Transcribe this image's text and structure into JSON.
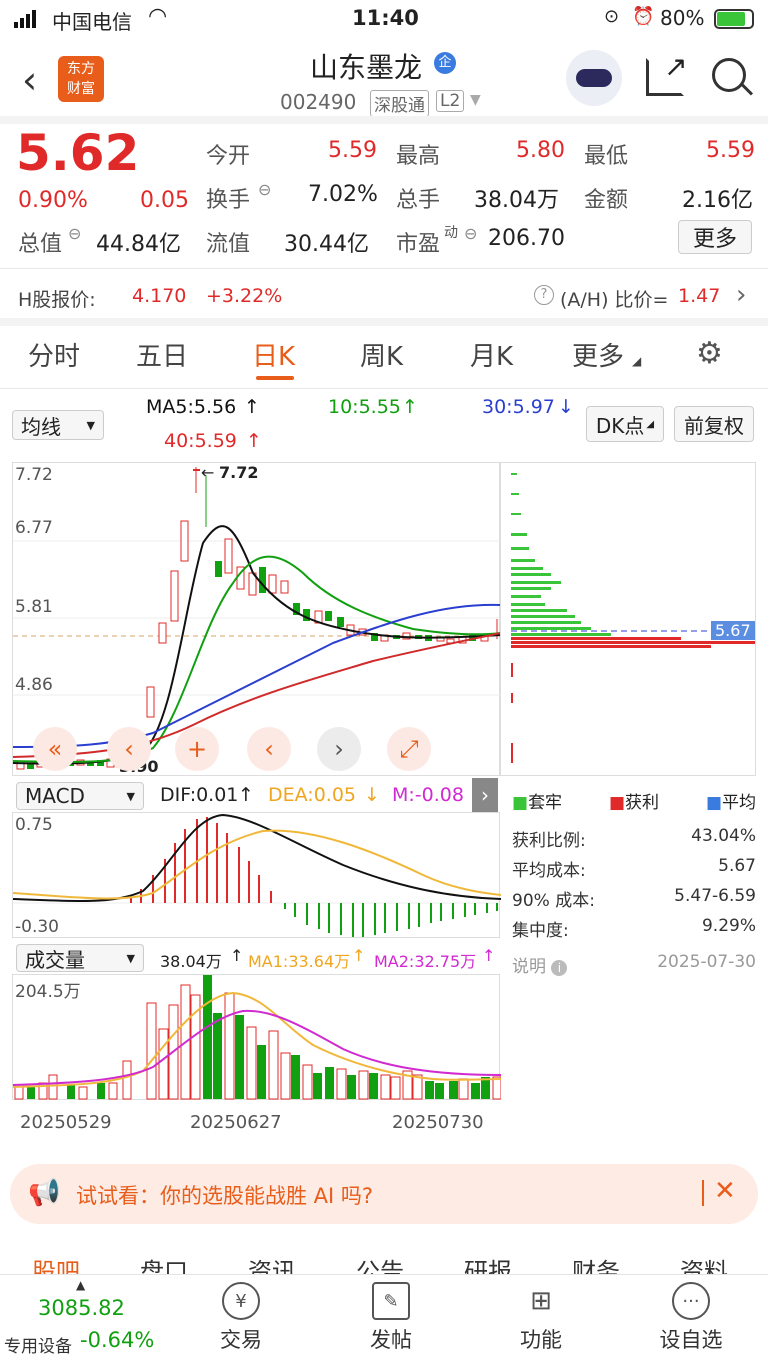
{
  "status_bar": {
    "carrier": "中国电信",
    "time": "11:40",
    "battery": "80%"
  },
  "header": {
    "title": "山东墨龙",
    "code": "002490",
    "market_tag": "深股通",
    "level_tag": "L2",
    "badge": "企",
    "logo_line1": "东方",
    "logo_line2": "财富"
  },
  "quote": {
    "price": "5.62",
    "change_pct": "0.90%",
    "change": "0.05",
    "open_label": "今开",
    "open": "5.59",
    "high_label": "最高",
    "high": "5.80",
    "low_label": "最低",
    "low": "5.59",
    "turnover_label": "换手",
    "turnover": "7.02%",
    "volume_label": "总手",
    "volume": "38.04万",
    "amount_label": "金额",
    "amount": "2.16亿",
    "total_cap_label": "总值",
    "total_cap": "44.84亿",
    "float_cap_label": "流值",
    "float_cap": "30.44亿",
    "pe_label": "市盈",
    "pe_sup": "动",
    "pe": "206.70",
    "more_label": "更多"
  },
  "h_share": {
    "label": "H股报价:",
    "price": "4.170",
    "change": "+3.22%",
    "ratio_label": "(A/H) 比价=",
    "ratio": "1.47"
  },
  "chart_tabs": [
    "分时",
    "五日",
    "日K",
    "周K",
    "月K",
    "更多"
  ],
  "ma_bar": {
    "selector": "均线",
    "ma5": "MA5:5.56",
    "ma10": "10:5.55",
    "ma30": "30:5.97",
    "ma40": "40:5.59",
    "dk": "DK点",
    "adjust": "前复权"
  },
  "price_axis": {
    "p1": "7.72",
    "p2": "6.77",
    "p3": "5.81",
    "p4": "4.86",
    "max_mark": "7.72",
    "min_mark": "3.90",
    "current_tag": "5.67"
  },
  "macd": {
    "selector": "MACD",
    "dif": "DIF:0.01",
    "dea": "DEA:0.05",
    "m": "M:-0.08",
    "top": "0.75",
    "bottom": "-0.30"
  },
  "volume_panel": {
    "selector": "成交量",
    "vol": "38.04万",
    "ma1": "MA1:33.64万",
    "ma2": "MA2:32.75万",
    "top": "204.5万"
  },
  "dates": {
    "d1": "20250529",
    "d2": "20250627",
    "d3": "20250730"
  },
  "chip": {
    "legend_trapped": "套牢",
    "legend_profit": "获利",
    "legend_avg": "平均",
    "profit_ratio_label": "获利比例:",
    "profit_ratio": "43.04%",
    "avg_cost_label": "平均成本:",
    "avg_cost": "5.67",
    "cost90_label": "90% 成本:",
    "cost90": "5.47-6.59",
    "concentration_label": "集中度:",
    "concentration": "9.29%",
    "note_label": "说明",
    "date": "2025-07-30"
  },
  "promo": {
    "text": "试试看：你的选股能战胜 AI 吗?"
  },
  "bottom_tabs": [
    "股吧",
    "盘口",
    "资讯",
    "公告",
    "研报",
    "财务",
    "资料"
  ],
  "dock": {
    "index_value": "3085.82",
    "index_label": "专用设备",
    "index_change": "-0.64%",
    "trade": "交易",
    "post": "发帖",
    "func": "功能",
    "watch": "设自选"
  },
  "chart_data": {
    "type": "candlestick",
    "x_start": "20250529",
    "x_mid": "20250627",
    "x_end": "20250730",
    "y_ticks": [
      7.72,
      6.77,
      5.81,
      4.86
    ],
    "high": 7.72,
    "low": 3.9,
    "last": 5.62,
    "ma": {
      "MA5": 5.56,
      "MA10": 5.55,
      "MA30": 5.97,
      "MA40": 5.59
    },
    "macd": {
      "DIF": 0.01,
      "DEA": 0.05,
      "M": -0.08,
      "range": [
        -0.3,
        0.75
      ]
    },
    "volume": {
      "last": "38.04万",
      "MA1": "33.64万",
      "MA2": "32.75万",
      "max": "204.5万"
    }
  },
  "colors": {
    "up": "#e02a2a",
    "down": "#10a010",
    "accent": "#e85d1a",
    "ma5": "#111111",
    "ma10": "#10a010",
    "ma30": "#2a3fd0",
    "ma40": "#d02a2a"
  }
}
